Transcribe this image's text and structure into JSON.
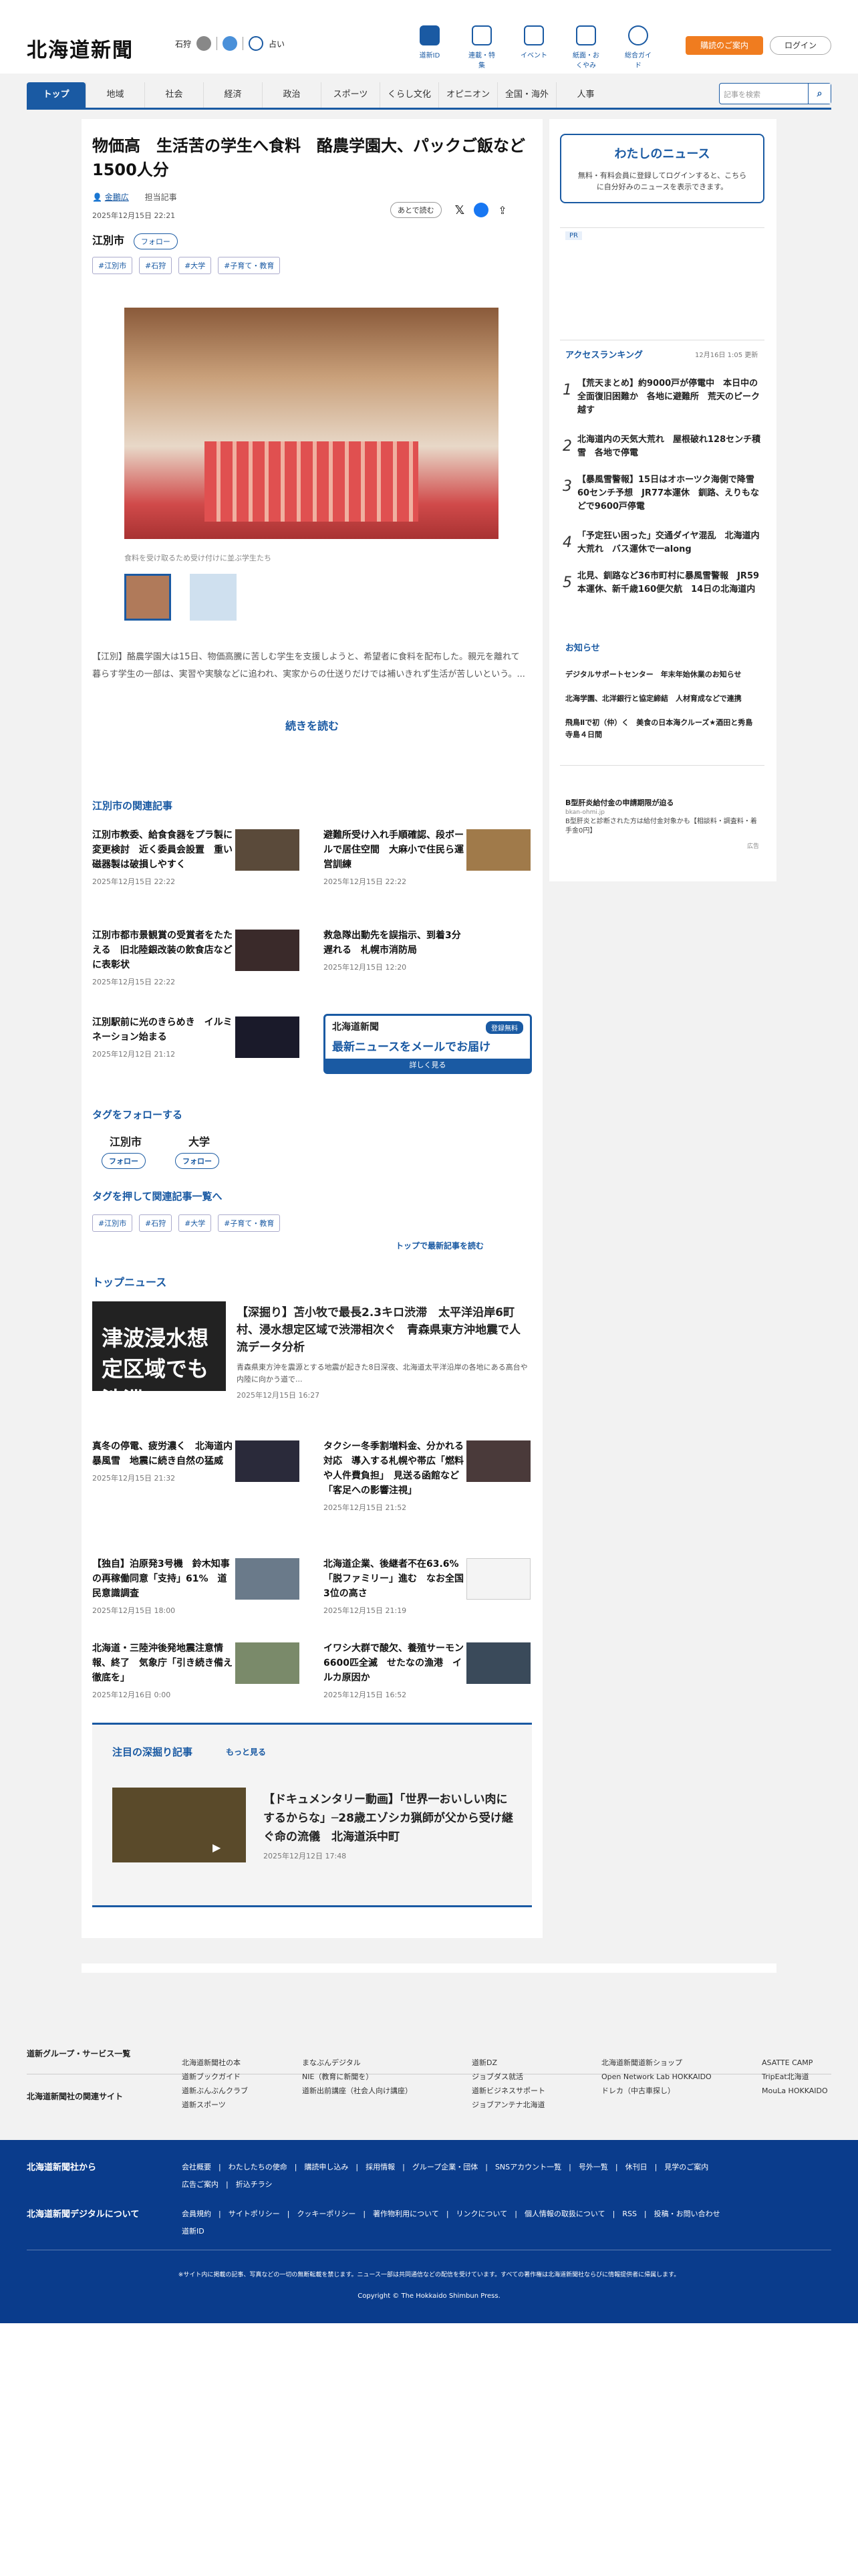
{
  "header": {
    "logo": "北海道新聞",
    "weather": {
      "city": "石狩",
      "label": "占い"
    },
    "nav": [
      "道新ID",
      "連載・特集",
      "イベント",
      "紙面・おくやみ",
      "総合ガイド"
    ],
    "buy": "購読のご案内",
    "login": "ログイン"
  },
  "gnav": [
    "トップ",
    "地域",
    "社会",
    "経済",
    "政治",
    "スポーツ",
    "くらし文化",
    "オピニオン",
    "全国・海外",
    "人事"
  ],
  "search": {
    "placeholder": "記事を検索"
  },
  "article": {
    "title": "物価高　生活苦の学生へ食料　酪農学園大、パックご飯など1500人分",
    "author": "金鵬広",
    "author_link": "担当記事",
    "date": "2025年12月15日 22:21",
    "save": "あとで読む",
    "city": "江別市",
    "follow": "フォロー",
    "tags": [
      "#江別市",
      "#石狩",
      "#大学",
      "#子育て・教育"
    ],
    "caption": "食料を受け取るため受け付けに並ぶ学生たち",
    "lead": "【江別】酪農学園大は15日、物価高騰に苦しむ学生を支援しようと、希望者に食料を配布した。親元を離れて暮らす学生の一部は、実習や実験などに追われ、実家からの仕送りだけでは補いきれず生活が苦しいという。...",
    "readmore": "続きを読む"
  },
  "related": {
    "heading": "江別市の関連記事",
    "items": [
      {
        "t": "江別市教委、給食食器をプラ製に変更検討　近く委員会設置　重い磁器製は破損しやすく",
        "d": "2025年12月15日 22:22"
      },
      {
        "t": "避難所受け入れ手順確認、段ボールで居住空間　大麻小で住民ら運営訓練",
        "d": "2025年12月15日 22:22"
      },
      {
        "t": "江別市都市景観賞の受賞者をたたえる　旧北陸銀改装の飲食店などに表彰状",
        "d": "2025年12月15日 22:22"
      },
      {
        "t": "救急隊出動先を誤指示、到着3分遅れる　札幌市消防局",
        "d": "2025年12月15日 12:20"
      },
      {
        "t": "江別駅前に光のきらめき　イルミネーション始まる",
        "d": "2025年12月12日 21:12"
      }
    ],
    "mail": {
      "brand": "北海道新聞",
      "badge": "登録無料",
      "text": "最新ニュースをメールでお届け",
      "more": "詳しく見る"
    }
  },
  "followtags": {
    "heading": "タグをフォローする",
    "items": [
      "江別市",
      "大学"
    ],
    "btn": "フォロー"
  },
  "tagrelated": {
    "heading": "タグを押して関連記事一覧へ",
    "more": "トップで最新記事を読む"
  },
  "topnews": {
    "heading": "トップニュース",
    "lead": {
      "t": "【深掘り】苫小牧で最長2.3キロ渋滞　太平洋沿岸6町村、浸水想定区域で渋滞相次ぐ　青森県東方沖地震で人流データ分析",
      "s": "青森県東方沖を震源とする地震が起きた8日深夜、北海道太平洋沿岸の各地にある高台や内陸に向かう道で...",
      "d": "2025年12月15日 16:27",
      "img": "津波浸水想定区域でも 渋滞"
    },
    "items": [
      {
        "t": "真冬の停電、疲労濃く　北海道内暴風雪　地震に続き自然の猛威",
        "d": "2025年12月15日 21:32"
      },
      {
        "t": "タクシー冬季割増料金、分かれる対応　導入する札幌や帯広「燃料や人件費負担」　見送る函館など「客足への影響注視」",
        "d": "2025年12月15日 21:52"
      },
      {
        "t": "【独自】泊原発3号機　鈴木知事の再稼働同意「支持」61%　道民意識調査",
        "d": "2025年12月15日 18:00"
      },
      {
        "t": "北海道企業、後継者不在63.6%「脱ファミリー」進む　なお全国3位の高さ",
        "d": "2025年12月15日 21:19"
      },
      {
        "t": "北海道・三陸沖後発地震注意情報、終了　気象庁「引き続き備え徹底を」",
        "d": "2025年12月16日 0:00"
      },
      {
        "t": "イワシ大群で酸欠、養殖サーモン6600匹全滅　せたなの漁港　イルカ原因か",
        "d": "2025年12月15日 16:52"
      }
    ]
  },
  "deep": {
    "heading": "注目の深掘り記事",
    "more": "もっと見る",
    "t": "【ドキュメンタリー動画】「世界一おいしい肉にするからな」─28歳エゾシカ猟師が父から受け継ぐ命の流儀　北海道浜中町",
    "d": "2025年12月12日 17:48"
  },
  "side": {
    "mynews": {
      "title": "わたしのニュース",
      "text": "無料・有料会員に登録してログインすると、こちらに自分好みのニュースを表示できます。"
    },
    "pr": "PR",
    "ranking": {
      "heading": "アクセスランキング",
      "updated": "12月16日 1:05 更新",
      "items": [
        "【荒天まとめ】約9000戸が停電中　本日中の全面復旧困難か　各地に避難所　荒天のピーク越す",
        "北海道内の天気大荒れ　屋根破れ128センチ積雪　各地で停電",
        "【暴風雪警報】15日はオホーツク海側で降雪60センチ予想　JR77本運休　釧路、えりもなどで9600戸停電",
        "「予定狂い困った」交通ダイヤ混乱　北海道内大荒れ　バス運休で一along",
        "北見、釧路など36市町村に暴風雪警報　JR59本運休、新千歳160便欠航　14日の北海道内"
      ]
    },
    "notice": {
      "heading": "お知らせ",
      "items": [
        "デジタルサポートセンター　年末年始休業のお知らせ",
        "北海学園、北洋銀行と協定締結　人材育成などで連携",
        "飛鳥Ⅱで初（仲）く　美食の日本海クルーズ★酒田と秀島寺島４日間"
      ]
    },
    "ad": {
      "t": "B型肝炎給付金の申請期限が迫る",
      "s": "bkan-ohmi.jp",
      "b": "B型肝炎と診断された方は給付金対象かも【相談料・調査料・着手金0円】",
      "label": "広告"
    }
  },
  "footer": {
    "group": "道新グループ・サービス一覧",
    "related": "北海道新聞社の関連サイト",
    "cols": [
      [
        "北海道新聞社の本",
        "道新ブックガイド",
        "道新ぶんぶんクラブ",
        "道新スポーツ"
      ],
      [
        "まなぶんデジタル",
        "NIE（教育に新聞を）",
        "道新出前講座（社会人向け講座）"
      ],
      [
        "道新DZ",
        "ジョブダス就活",
        "道新ビジネスサポート",
        "ジョブアンテナ北海道"
      ],
      [
        "北海道新聞道新ショップ",
        "Open Network Lab HOKKAIDO",
        "ドレカ（中古車探し）"
      ],
      [
        "ASATTE CAMP",
        "TripEat北海道",
        "MouLa HOKKAIDO"
      ]
    ],
    "from": "北海道新聞社から",
    "fromlinks": [
      "会社概要",
      "わたしたちの使命",
      "購読申し込み",
      "採用情報",
      "グループ企業・団体",
      "SNSアカウント一覧",
      "号外一覧",
      "休刊日",
      "見学のご案内",
      "広告ご案内",
      "折込チラシ"
    ],
    "digital": "北海道新聞デジタルについて",
    "digitallinks": [
      "会員規約",
      "サイトポリシー",
      "クッキーポリシー",
      "著作物利用について",
      "リンクについて",
      "個人情報の取扱について",
      "RSS",
      "投稿・お問い合わせ",
      "道新ID"
    ],
    "notice": "※サイト内に掲載の記事、写真などの一切の無断転載を禁じます。ニュース一部は共同通信などの配信を受けています。すべての著作権は北海道新聞社ならびに情報提供者に帰属します。",
    "copyright": "Copyright © The Hokkaido Shimbun Press."
  }
}
